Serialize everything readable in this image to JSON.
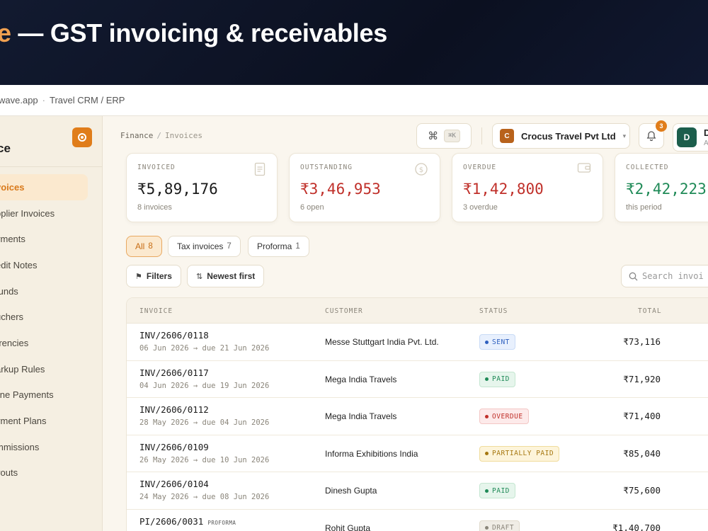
{
  "banner": {
    "title_accent": "e",
    "title_rest": " — GST invoicing & receivables"
  },
  "browser": {
    "url": "wave.app",
    "separator": "·",
    "page_title": "Travel CRM / ERP"
  },
  "sidebar": {
    "title": "ce",
    "items": [
      {
        "label": "voices",
        "active": true
      },
      {
        "label": "pplier Invoices"
      },
      {
        "label": "yments"
      },
      {
        "label": "edit Notes"
      },
      {
        "label": "funds"
      },
      {
        "label": "uchers"
      },
      {
        "label": "rrencies"
      },
      {
        "label": "arkup Rules"
      },
      {
        "label": "line Payments"
      },
      {
        "label": "yment Plans"
      },
      {
        "label": "mmissions"
      },
      {
        "label": "youts"
      }
    ]
  },
  "topbar": {
    "breadcrumb": {
      "parent": "Finance",
      "sep": "/",
      "current": "Invoices"
    },
    "command": {
      "icon": "⌘",
      "shortcut": "⌘K"
    },
    "org": {
      "avatar": "C",
      "name": "Crocus Travel Pvt Ltd",
      "chevron": "▾"
    },
    "notifications": {
      "count": "3"
    },
    "user": {
      "avatar": "D",
      "name": "D",
      "role": "A"
    }
  },
  "stats": [
    {
      "label": "INVOICED",
      "value": "₹5,89,176",
      "sub": "8 invoices",
      "icon": "document-icon"
    },
    {
      "label": "OUTSTANDING",
      "value": "₹3,46,953",
      "sub": "6 open",
      "icon": "dollar-icon",
      "color": "#c0302a"
    },
    {
      "label": "OVERDUE",
      "value": "₹1,42,800",
      "sub": "3 overdue",
      "icon": "wallet-icon",
      "color": "#c0302a"
    },
    {
      "label": "COLLECTED",
      "value": "₹2,42,223",
      "sub": "this period",
      "color": "#1f8a57"
    }
  ],
  "tabs": [
    {
      "label": "All",
      "count": "8",
      "active": true
    },
    {
      "label": "Tax invoices",
      "count": "7"
    },
    {
      "label": "Proforma",
      "count": "1"
    }
  ],
  "controls": {
    "filters": {
      "icon": "⚑",
      "label": "Filters"
    },
    "sort": {
      "icon": "⇅",
      "label": "Newest first"
    },
    "search_placeholder": "Search invoi"
  },
  "table": {
    "headers": {
      "invoice": "INVOICE",
      "customer": "CUSTOMER",
      "status": "STATUS",
      "total": "TOTAL"
    },
    "rows": [
      {
        "id": "INV/2606/0118",
        "dates": "06 Jun 2026 → due 21 Jun 2026",
        "customer": "Messe Stuttgart India Pvt. Ltd.",
        "status": "SENT",
        "status_kind": "sent",
        "total": "₹73,116"
      },
      {
        "id": "INV/2606/0117",
        "dates": "04 Jun 2026 → due 19 Jun 2026",
        "customer": "Mega India Travels",
        "status": "PAID",
        "status_kind": "paid",
        "total": "₹71,920"
      },
      {
        "id": "INV/2606/0112",
        "dates": "28 May 2026 → due 04 Jun 2026",
        "customer": "Mega India Travels",
        "status": "OVERDUE",
        "status_kind": "overdue",
        "total": "₹71,400"
      },
      {
        "id": "INV/2606/0109",
        "dates": "26 May 2026 → due 10 Jun 2026",
        "customer": "Informa Exhibitions India",
        "status": "PARTIALLY PAID",
        "status_kind": "partial",
        "total": "₹85,040"
      },
      {
        "id": "INV/2606/0104",
        "dates": "24 May 2026 → due 08 Jun 2026",
        "customer": "Dinesh Gupta",
        "status": "PAID",
        "status_kind": "paid",
        "total": "₹75,600"
      },
      {
        "id": "PI/2606/0031",
        "tag": "PROFORMA",
        "dates": "",
        "customer": "Rohit Gupta",
        "status": "DRAFT",
        "status_kind": "draft",
        "total": "₹1,40,700"
      }
    ]
  }
}
